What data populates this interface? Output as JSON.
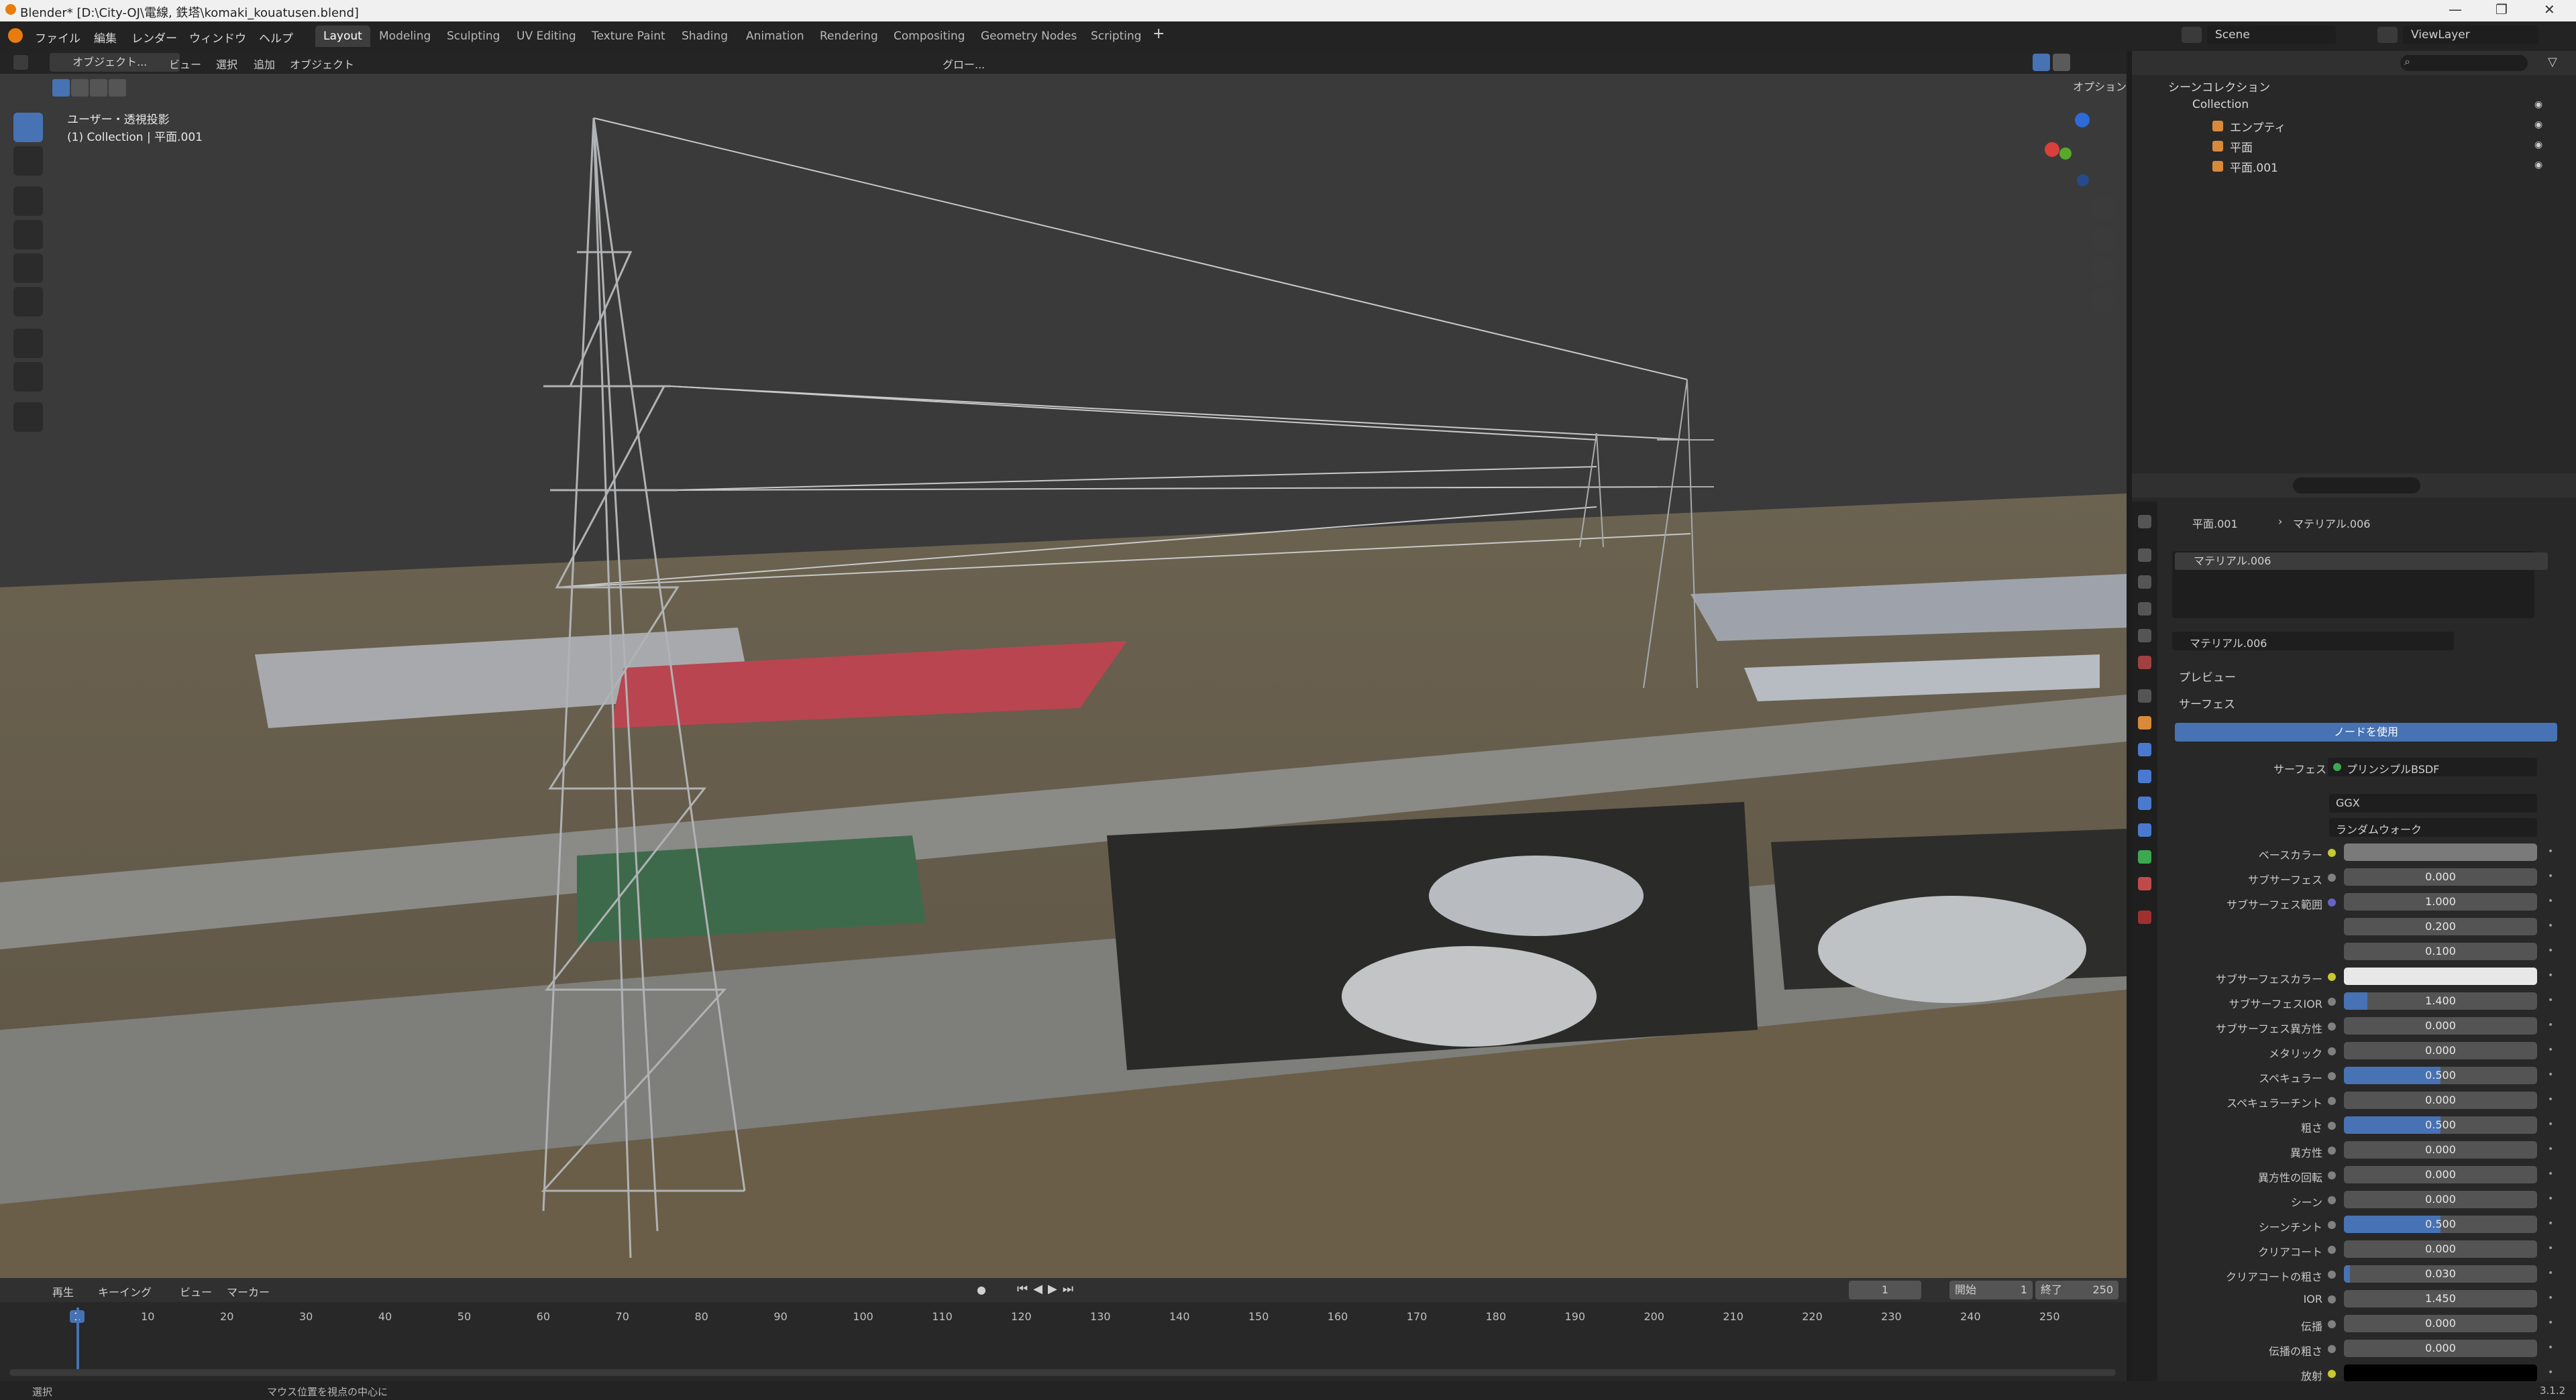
{
  "window": {
    "title": "Blender* [D:\\City-OJ\\電線, 鉄塔\\komaki_kouatusen.blend]"
  },
  "menu": {
    "items": [
      "ファイル",
      "編集",
      "レンダー",
      "ウィンドウ",
      "ヘルプ"
    ]
  },
  "workspaces": {
    "tabs": [
      "Layout",
      "Modeling",
      "Sculpting",
      "UV Editing",
      "Texture Paint",
      "Shading",
      "Animation",
      "Rendering",
      "Compositing",
      "Geometry Nodes",
      "Scripting"
    ],
    "active": "Layout"
  },
  "scene": {
    "label": "Scene",
    "view_layer": "ViewLayer"
  },
  "viewport_header": {
    "mode": "オブジェクト...",
    "view": "ビュー",
    "select": "選択",
    "add": "追加",
    "object": "オブジェクト",
    "transform": "グロー...",
    "options": "オプション"
  },
  "viewport_overlay": {
    "projection": "ユーザー・透視投影",
    "context": "(1) Collection | 平面.001"
  },
  "outliner": {
    "title": "シーンコレクション",
    "items": [
      {
        "label": "Collection"
      },
      {
        "label": "エンプティ"
      },
      {
        "label": "平面"
      },
      {
        "label": "平面.001"
      }
    ]
  },
  "properties": {
    "breadcrumb_object": "平面.001",
    "breadcrumb_material": "マテリアル.006",
    "slot_name": "マテリアル.006",
    "material_name": "マテリアル.006",
    "preview_label": "プレビュー",
    "surface_label": "サーフェス",
    "use_nodes_label": "ノードを使用",
    "surface_shader_label": "サーフェス",
    "surface_shader": "プリンシプルBSDF",
    "distribution": "GGX",
    "subsurface_method": "ランダムウォーク",
    "rows": [
      {
        "label": "ベースカラー",
        "value": "",
        "fill": 0,
        "color": "#7a7a7a",
        "dot": "#c8c832"
      },
      {
        "label": "サブサーフェス",
        "value": "0.000",
        "fill": 0,
        "dot": "#808080"
      },
      {
        "label": "サブサーフェス範囲",
        "value": "1.000",
        "fill": 0,
        "dot": "#6464c8"
      },
      {
        "label": "",
        "value": "0.200",
        "fill": 0,
        "dot": ""
      },
      {
        "label": "",
        "value": "0.100",
        "fill": 0,
        "dot": ""
      },
      {
        "label": "サブサーフェスカラー",
        "value": "",
        "fill": 0,
        "color": "#e8e8e8",
        "dot": "#c8c832"
      },
      {
        "label": "サブサーフェスIOR",
        "value": "1.400",
        "fill": 0.12,
        "dot": "#808080"
      },
      {
        "label": "サブサーフェス異方性",
        "value": "0.000",
        "fill": 0,
        "dot": "#808080"
      },
      {
        "label": "メタリック",
        "value": "0.000",
        "fill": 0,
        "dot": "#808080"
      },
      {
        "label": "スペキュラー",
        "value": "0.500",
        "fill": 0.5,
        "dot": "#808080"
      },
      {
        "label": "スペキュラーチント",
        "value": "0.000",
        "fill": 0,
        "dot": "#808080"
      },
      {
        "label": "粗さ",
        "value": "0.500",
        "fill": 0.5,
        "dot": "#808080"
      },
      {
        "label": "異方性",
        "value": "0.000",
        "fill": 0,
        "dot": "#808080"
      },
      {
        "label": "異方性の回転",
        "value": "0.000",
        "fill": 0,
        "dot": "#808080"
      },
      {
        "label": "シーン",
        "value": "0.000",
        "fill": 0,
        "dot": "#808080"
      },
      {
        "label": "シーンチント",
        "value": "0.500",
        "fill": 0.5,
        "dot": "#808080"
      },
      {
        "label": "クリアコート",
        "value": "0.000",
        "fill": 0,
        "dot": "#808080"
      },
      {
        "label": "クリアコートの粗さ",
        "value": "0.030",
        "fill": 0.03,
        "dot": "#808080"
      },
      {
        "label": "IOR",
        "value": "1.450",
        "fill": 0,
        "dot": "#808080"
      },
      {
        "label": "伝播",
        "value": "0.000",
        "fill": 0,
        "dot": "#808080"
      },
      {
        "label": "伝播の粗さ",
        "value": "0.000",
        "fill": 0,
        "dot": "#808080"
      },
      {
        "label": "放射",
        "value": "",
        "fill": 0,
        "color": "#000000",
        "dot": "#c8c832"
      }
    ]
  },
  "timeline": {
    "play": "再生",
    "keying": "キーイング",
    "view": "ビュー",
    "marker": "マーカー",
    "current_frame": "1",
    "start_label": "開始",
    "start": "1",
    "end_label": "終了",
    "end": "250",
    "ticks": [
      "1",
      "10",
      "20",
      "30",
      "40",
      "50",
      "60",
      "70",
      "80",
      "90",
      "100",
      "110",
      "120",
      "130",
      "140",
      "150",
      "160",
      "170",
      "180",
      "190",
      "200",
      "210",
      "220",
      "230",
      "240",
      "250"
    ]
  },
  "status": {
    "left": "選択",
    "middle": "マウス位置を視点の中心に",
    "version": "3.1.2"
  }
}
